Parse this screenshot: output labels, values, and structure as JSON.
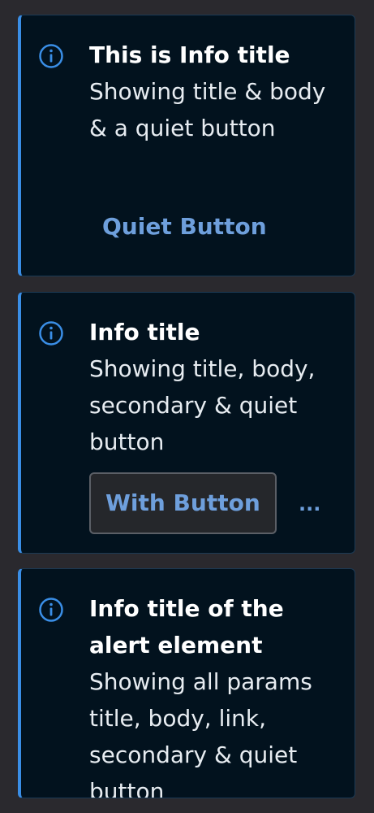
{
  "colors": {
    "background": "#2a292e",
    "alert_background": "#02121e",
    "alert_accent": "#3a8ee6",
    "link": "#6e9fdc"
  },
  "alerts": [
    {
      "icon": "info-icon",
      "title": "This is Info title",
      "body": "Showing title & body & a quiet button",
      "quiet_button": "Quiet Button"
    },
    {
      "icon": "info-icon",
      "title": "Info title",
      "body": "Showing title, body, secondary & quiet button",
      "secondary_button": "With Button",
      "more_button": "..."
    },
    {
      "icon": "info-icon",
      "title": "Info title of the alert element",
      "body": "Showing all params title, body, link, secondary & quiet button"
    }
  ]
}
